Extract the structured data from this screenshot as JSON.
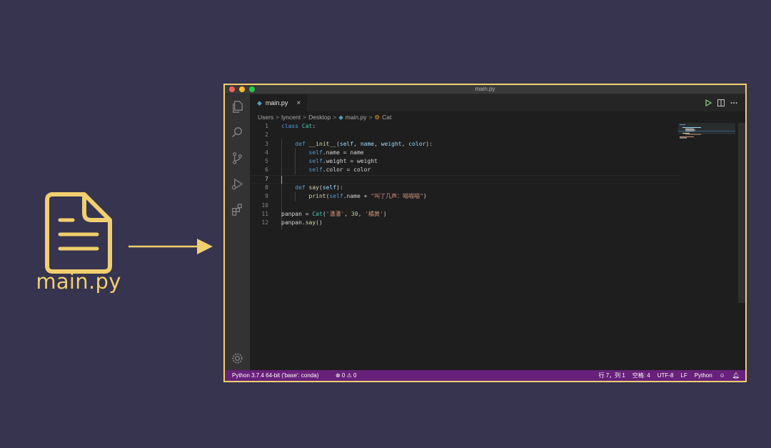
{
  "illustration": {
    "file_caption": "main.py"
  },
  "window": {
    "title": "main.py",
    "traffic_lights": {
      "close": "#ff5f56",
      "minimize": "#ffbd2e",
      "zoom": "#27c93f"
    }
  },
  "activity_bar": {
    "icons": [
      "files-icon",
      "search-icon",
      "source-control-icon",
      "run-debug-icon",
      "extensions-icon",
      "settings-gear-icon"
    ]
  },
  "tab": {
    "file_icon": "python-file-icon",
    "label": "main.py",
    "close": "×"
  },
  "breadcrumb": {
    "parts": [
      "Users",
      "lyncent",
      "Desktop",
      "main.py",
      "Cat"
    ],
    "separator": ">"
  },
  "code": {
    "line_numbers": [
      "1",
      "2",
      "3",
      "4",
      "5",
      "6",
      "7",
      "8",
      "9",
      "10",
      "11",
      "12"
    ],
    "lines": [
      "class Cat:",
      "",
      "    def __init__(self, name, weight, color):",
      "        self.name = name",
      "        self.weight = weight",
      "        self.color = color",
      "",
      "    def say(self):",
      "        print(self.name + \"叫了几声：喵喵喵\")",
      "",
      "panpan = Cat('潘潘', 30, '橘黄')",
      "panpan.say()"
    ],
    "current_line": 7
  },
  "status_bar": {
    "interpreter": "Python 3.7.4 64-bit ('base': conda)",
    "problems": "⊗ 0 ⚠ 0",
    "position": "行 7，列 1",
    "spaces": "空格: 4",
    "encoding": "UTF-8",
    "eol": "LF",
    "language": "Python",
    "background": "#68217a"
  },
  "colors": {
    "page_bg": "#37344f",
    "accent": "#f0cf72"
  }
}
